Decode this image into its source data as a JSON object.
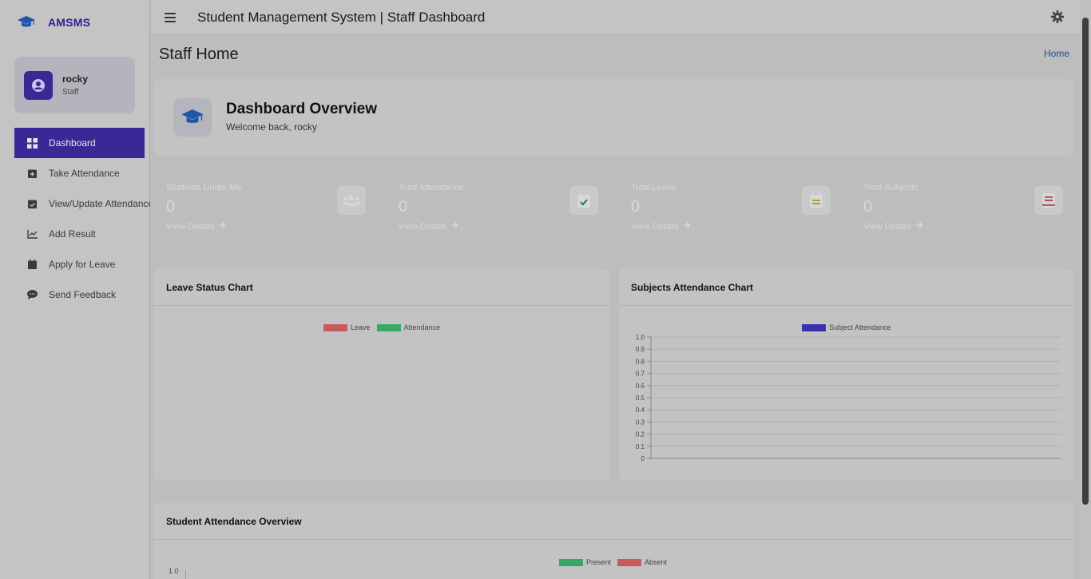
{
  "brand": {
    "name": "AMSMS"
  },
  "user": {
    "name": "rocky",
    "role": "Staff"
  },
  "sidebar": {
    "items": [
      {
        "label": "Dashboard",
        "icon": "dashboard-icon",
        "active": true
      },
      {
        "label": "Take Attendance",
        "icon": "calendar-plus-icon"
      },
      {
        "label": "View/Update Attendance",
        "icon": "calendar-check-icon"
      },
      {
        "label": "Add Result",
        "icon": "chart-line-icon"
      },
      {
        "label": "Apply for Leave",
        "icon": "calendar-icon"
      },
      {
        "label": "Send Feedback",
        "icon": "comment-icon"
      }
    ]
  },
  "header": {
    "title": "Student Management System | Staff Dashboard"
  },
  "page": {
    "title": "Staff Home",
    "breadcrumb": "Home"
  },
  "overview": {
    "title": "Dashboard Overview",
    "subtitle": "Welcome back, rocky"
  },
  "stats": [
    {
      "label": "Students Under Me",
      "value": "0",
      "link": "View Details",
      "color": "#1a7a88",
      "icon": "users-icon"
    },
    {
      "label": "Total Attendance",
      "value": "0",
      "link": "View Details",
      "color": "#247a40",
      "icon": "calendar-check-icon"
    },
    {
      "label": "Total Leave",
      "value": "0",
      "link": "View Details",
      "color": "#b58a06",
      "icon": "calendar-icon"
    },
    {
      "label": "Total Subjects",
      "value": "0",
      "link": "View Details",
      "color": "#a42a36",
      "icon": "book-icon"
    }
  ],
  "colors": {
    "accent": "#3a2896",
    "link": "#1d4f91"
  },
  "cards": {
    "leave": {
      "title": "Leave Status Chart"
    },
    "subjects": {
      "title": "Subjects Attendance Chart"
    },
    "students": {
      "title": "Student Attendance Overview"
    }
  },
  "chart_data": [
    {
      "type": "bar",
      "title": "Leave Status Chart",
      "series": [
        {
          "name": "Leave",
          "color": "#c85a5f",
          "values": []
        },
        {
          "name": "Attendance",
          "color": "#3aa865",
          "values": []
        }
      ],
      "categories": []
    },
    {
      "type": "bar",
      "title": "Subjects Attendance Chart",
      "series": [
        {
          "name": "Subject Attendance",
          "color": "#3b30b0",
          "values": []
        }
      ],
      "categories": [],
      "ylim": [
        0,
        1.0
      ],
      "yticks": [
        "1.0",
        "0.9",
        "0.8",
        "0.7",
        "0.6",
        "0.5",
        "0.4",
        "0.3",
        "0.2",
        "0.1",
        "0"
      ],
      "grid": true,
      "legend": "top"
    },
    {
      "type": "bar",
      "title": "Student Attendance Overview",
      "series": [
        {
          "name": "Present",
          "color": "#3aa865",
          "values": []
        },
        {
          "name": "Absent",
          "color": "#c85a5f",
          "values": []
        }
      ],
      "categories": [],
      "yticks": [
        "1.0"
      ],
      "legend": "top"
    }
  ]
}
